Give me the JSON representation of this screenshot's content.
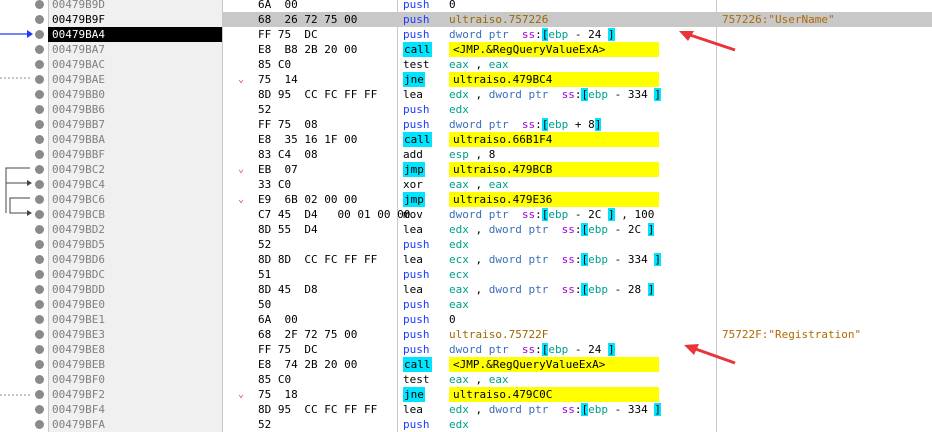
{
  "rows": [
    {
      "addr": "00479B9D",
      "bytes": "6A  00",
      "mn": "push",
      "ops": [
        [
          "n",
          "0"
        ]
      ]
    },
    {
      "addr": "00479B9F",
      "bytes": "68  26 72 75 00",
      "mn": "push",
      "ops": [
        [
          "l",
          "ultraiso.757226"
        ]
      ],
      "cmt": "757226:\"UserName\"",
      "hl": true
    },
    {
      "addr": "00479BA4",
      "bytes": "FF 75  DC",
      "mn": "push",
      "ops": [
        [
          "k",
          "dword ptr  "
        ],
        [
          "s",
          "ss"
        ],
        [
          "n",
          ":"
        ],
        [
          "b",
          "["
        ],
        [
          "r",
          "ebp"
        ],
        [
          "n",
          " - 24 "
        ],
        [
          "b",
          "]"
        ]
      ],
      "cur": true
    },
    {
      "addr": "00479BA7",
      "bytes": "E8  B8 2B 20 00",
      "mn": "call",
      "mcyan": true,
      "yops": true,
      "ops": [
        [
          "n",
          "<JMP.&RegQueryValueExA>"
        ]
      ]
    },
    {
      "addr": "00479BAC",
      "bytes": "85 C0",
      "mn": "test",
      "ops": [
        [
          "r",
          "eax"
        ],
        [
          "n",
          " , "
        ],
        [
          "r",
          "eax"
        ]
      ]
    },
    {
      "addr": "00479BAE",
      "bytes": "75  14",
      "mn": "jne",
      "mcyan": true,
      "yops": true,
      "chev": true,
      "ops": [
        [
          "n",
          "ultraiso.479BC4"
        ]
      ]
    },
    {
      "addr": "00479BB0",
      "bytes": "8D 95  CC FC FF FF",
      "mn": "lea",
      "ops": [
        [
          "r",
          "edx"
        ],
        [
          "n",
          " , "
        ],
        [
          "k",
          "dword ptr  "
        ],
        [
          "s",
          "ss"
        ],
        [
          "n",
          ":"
        ],
        [
          "b",
          "["
        ],
        [
          "r",
          "ebp"
        ],
        [
          "n",
          " - 334 "
        ],
        [
          "b",
          "]"
        ]
      ]
    },
    {
      "addr": "00479BB6",
      "bytes": "52",
      "mn": "push",
      "ops": [
        [
          "r",
          "edx"
        ]
      ]
    },
    {
      "addr": "00479BB7",
      "bytes": "FF 75  08",
      "mn": "push",
      "ops": [
        [
          "k",
          "dword ptr  "
        ],
        [
          "s",
          "ss"
        ],
        [
          "n",
          ":"
        ],
        [
          "b",
          "["
        ],
        [
          "r",
          "ebp"
        ],
        [
          "n",
          " + 8"
        ],
        [
          "b",
          "]"
        ]
      ]
    },
    {
      "addr": "00479BBA",
      "bytes": "E8  35 16 1F 00",
      "mn": "call",
      "mcyan": true,
      "yops": true,
      "ops": [
        [
          "n",
          "ultraiso.66B1F4"
        ]
      ]
    },
    {
      "addr": "00479BBF",
      "bytes": "83 C4  08",
      "mn": "add",
      "ops": [
        [
          "r",
          "esp"
        ],
        [
          "n",
          " , 8"
        ]
      ]
    },
    {
      "addr": "00479BC2",
      "bytes": "EB  07",
      "mn": "jmp",
      "mcyan": true,
      "yops": true,
      "chev": true,
      "ops": [
        [
          "n",
          "ultraiso.479BCB"
        ]
      ]
    },
    {
      "addr": "00479BC4",
      "bytes": "33 C0",
      "mn": "xor",
      "ops": [
        [
          "r",
          "eax"
        ],
        [
          "n",
          " , "
        ],
        [
          "r",
          "eax"
        ]
      ]
    },
    {
      "addr": "00479BC6",
      "bytes": "E9  6B 02 00 00",
      "mn": "jmp",
      "mcyan": true,
      "yops": true,
      "chev": true,
      "ops": [
        [
          "n",
          "ultraiso.479E36"
        ]
      ]
    },
    {
      "addr": "00479BCB",
      "bytes": "C7 45  D4   00 01 00 00",
      "mn": "mov",
      "ops": [
        [
          "k",
          "dword ptr  "
        ],
        [
          "s",
          "ss"
        ],
        [
          "n",
          ":"
        ],
        [
          "b",
          "["
        ],
        [
          "r",
          "ebp"
        ],
        [
          "n",
          " - 2C "
        ],
        [
          "b",
          "]"
        ],
        [
          "n",
          " , 100"
        ]
      ]
    },
    {
      "addr": "00479BD2",
      "bytes": "8D 55  D4",
      "mn": "lea",
      "ops": [
        [
          "r",
          "edx"
        ],
        [
          "n",
          " , "
        ],
        [
          "k",
          "dword ptr  "
        ],
        [
          "s",
          "ss"
        ],
        [
          "n",
          ":"
        ],
        [
          "b",
          "["
        ],
        [
          "r",
          "ebp"
        ],
        [
          "n",
          " - 2C "
        ],
        [
          "b",
          "]"
        ]
      ]
    },
    {
      "addr": "00479BD5",
      "bytes": "52",
      "mn": "push",
      "ops": [
        [
          "r",
          "edx"
        ]
      ]
    },
    {
      "addr": "00479BD6",
      "bytes": "8D 8D  CC FC FF FF",
      "mn": "lea",
      "ops": [
        [
          "r",
          "ecx"
        ],
        [
          "n",
          " , "
        ],
        [
          "k",
          "dword ptr  "
        ],
        [
          "s",
          "ss"
        ],
        [
          "n",
          ":"
        ],
        [
          "b",
          "["
        ],
        [
          "r",
          "ebp"
        ],
        [
          "n",
          " - 334 "
        ],
        [
          "b",
          "]"
        ]
      ]
    },
    {
      "addr": "00479BDC",
      "bytes": "51",
      "mn": "push",
      "ops": [
        [
          "r",
          "ecx"
        ]
      ]
    },
    {
      "addr": "00479BDD",
      "bytes": "8D 45  D8",
      "mn": "lea",
      "ops": [
        [
          "r",
          "eax"
        ],
        [
          "n",
          " , "
        ],
        [
          "k",
          "dword ptr  "
        ],
        [
          "s",
          "ss"
        ],
        [
          "n",
          ":"
        ],
        [
          "b",
          "["
        ],
        [
          "r",
          "ebp"
        ],
        [
          "n",
          " - 28 "
        ],
        [
          "b",
          "]"
        ]
      ]
    },
    {
      "addr": "00479BE0",
      "bytes": "50",
      "mn": "push",
      "ops": [
        [
          "r",
          "eax"
        ]
      ]
    },
    {
      "addr": "00479BE1",
      "bytes": "6A  00",
      "mn": "push",
      "ops": [
        [
          "n",
          "0"
        ]
      ]
    },
    {
      "addr": "00479BE3",
      "bytes": "68  2F 72 75 00",
      "mn": "push",
      "ops": [
        [
          "l",
          "ultraiso.75722F"
        ]
      ],
      "cmt": "75722F:\"Registration\""
    },
    {
      "addr": "00479BE8",
      "bytes": "FF 75  DC",
      "mn": "push",
      "ops": [
        [
          "k",
          "dword ptr  "
        ],
        [
          "s",
          "ss"
        ],
        [
          "n",
          ":"
        ],
        [
          "b",
          "["
        ],
        [
          "r",
          "ebp"
        ],
        [
          "n",
          " - 24 "
        ],
        [
          "b",
          "]"
        ]
      ]
    },
    {
      "addr": "00479BEB",
      "bytes": "E8  74 2B 20 00",
      "mn": "call",
      "mcyan": true,
      "yops": true,
      "ops": [
        [
          "n",
          "<JMP.&RegQueryValueExA>"
        ]
      ]
    },
    {
      "addr": "00479BF0",
      "bytes": "85 C0",
      "mn": "test",
      "ops": [
        [
          "r",
          "eax"
        ],
        [
          "n",
          " , "
        ],
        [
          "r",
          "eax"
        ]
      ]
    },
    {
      "addr": "00479BF2",
      "bytes": "75  18",
      "mn": "jne",
      "mcyan": true,
      "yops": true,
      "chev": true,
      "ops": [
        [
          "n",
          "ultraiso.479C0C"
        ]
      ]
    },
    {
      "addr": "00479BF4",
      "bytes": "8D 95  CC FC FF FF",
      "mn": "lea",
      "ops": [
        [
          "r",
          "edx"
        ],
        [
          "n",
          " , "
        ],
        [
          "k",
          "dword ptr  "
        ],
        [
          "s",
          "ss"
        ],
        [
          "n",
          ":"
        ],
        [
          "b",
          "["
        ],
        [
          "r",
          "ebp"
        ],
        [
          "n",
          " - 334 "
        ],
        [
          "b",
          "]"
        ]
      ]
    },
    {
      "addr": "00479BFA",
      "bytes": "52",
      "mn": "push",
      "ops": [
        [
          "r",
          "edx"
        ]
      ]
    }
  ],
  "chevron_glyph": "⌄",
  "colors": {
    "highlight_row": "#c8c8c8",
    "branch": "#00e5ff",
    "target": "#ffff00",
    "annotation_arrow": "#e8353a",
    "push": "#1a3aff",
    "comment": "#b06a00"
  }
}
